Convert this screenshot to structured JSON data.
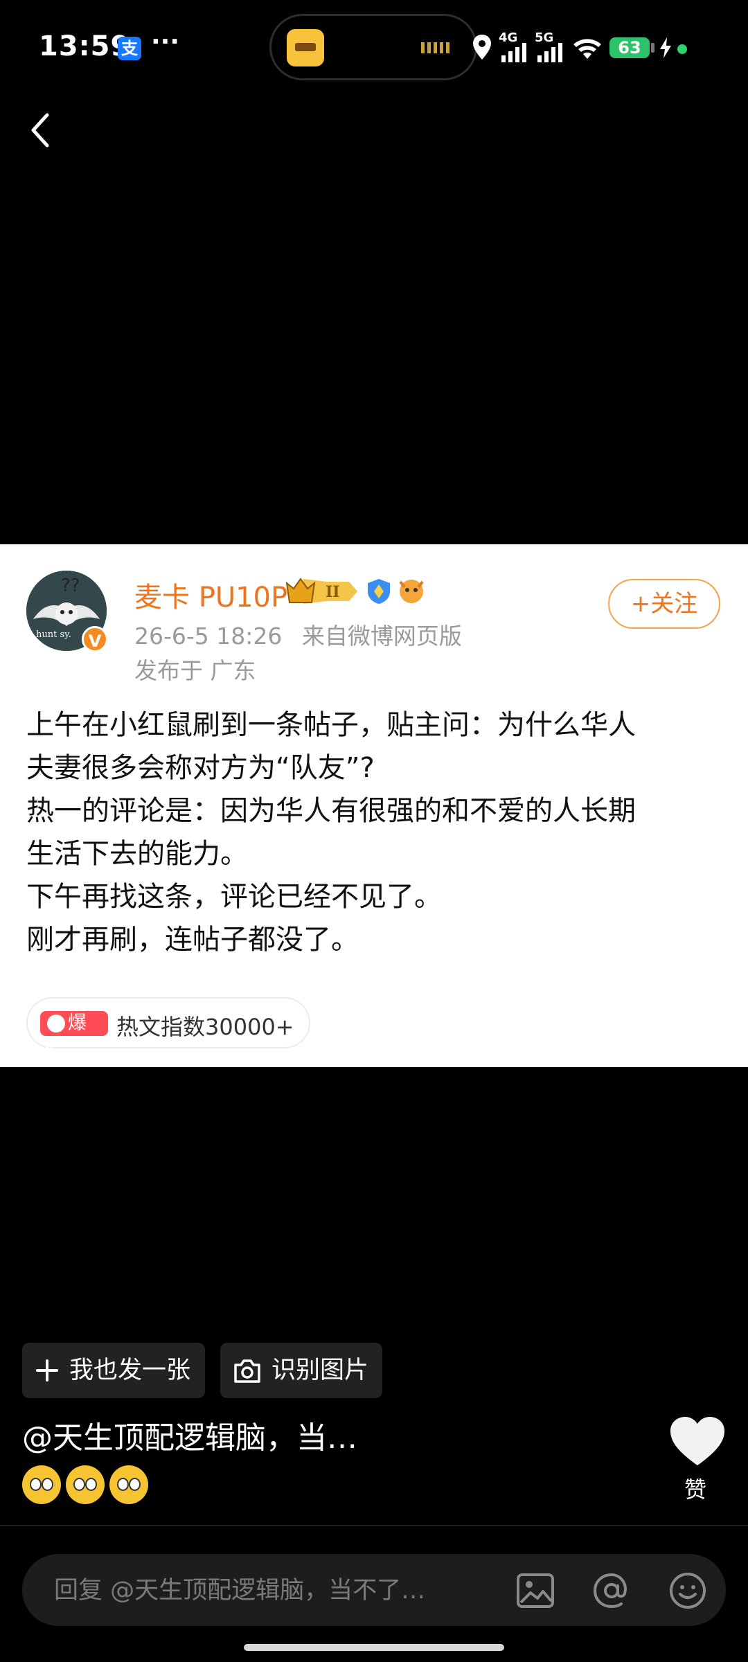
{
  "status_bar": {
    "time": "13:59",
    "alipay_glyph": "支",
    "dots": "···",
    "network_1": "4G",
    "network_2": "5G",
    "battery": "63"
  },
  "post": {
    "author": "麦卡 PU10P",
    "verified_glyph": "V",
    "timestamp": "26-6-5 18:26",
    "source": "来自微博网页版",
    "location": "发布于 广东",
    "follow_label": "+关注",
    "body": [
      "上午在小红鼠刷到一条帖子，贴主问：为什么华人",
      "夫妻很多会称对方为“队友”?",
      "热一的评论是：因为华人有很强的和不爱的人长期",
      "生活下去的能力。",
      "下午再找这条，评论已经不见了。",
      "刚才再刷，连帖子都没了。"
    ],
    "hot_badge": "爆文",
    "hot_index": "热文指数30000+",
    "badge_level": "II",
    "avatar_text": "hunt sy."
  },
  "actions": {
    "post_one": "我也发一张",
    "recognize": "识别图片"
  },
  "comment": {
    "mention": "@天生顶配逻辑脑，当…",
    "emoji_count": 3
  },
  "like": {
    "label": "赞"
  },
  "reply": {
    "placeholder": "回复 @天生顶配逻辑脑，当不了…"
  },
  "icons": [
    "back-icon",
    "location-icon",
    "signal-icon",
    "wifi-icon",
    "battery-icon",
    "charging-icon",
    "plus-icon",
    "camera-icon",
    "heart-icon",
    "image-icon",
    "at-icon",
    "emoji-icon"
  ],
  "colors": {
    "accent": "#f0741c",
    "hot": "#ff4c55",
    "background": "#000000",
    "card": "#ffffff"
  }
}
